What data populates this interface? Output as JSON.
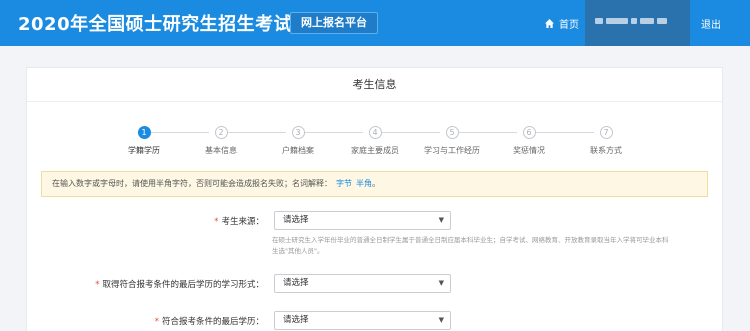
{
  "header": {
    "title": "2020年全国硕士研究生招生考试",
    "platform": "网上报名平台",
    "home": "首页",
    "logout": "退出"
  },
  "card": {
    "title": "考生信息"
  },
  "steps": [
    {
      "num": "1",
      "label": "学籍学历",
      "active": true
    },
    {
      "num": "2",
      "label": "基本信息",
      "active": false
    },
    {
      "num": "3",
      "label": "户籍档案",
      "active": false
    },
    {
      "num": "4",
      "label": "家庭主要成员",
      "active": false
    },
    {
      "num": "5",
      "label": "学习与工作经历",
      "active": false
    },
    {
      "num": "6",
      "label": "奖惩情况",
      "active": false
    },
    {
      "num": "7",
      "label": "联系方式",
      "active": false
    }
  ],
  "notice": {
    "text": "在输入数字或字母时，请使用半角字符，否则可能会造成报名失败；名词解释：",
    "link1": "字节",
    "link2": "半角",
    "end": "。"
  },
  "form": {
    "source": {
      "label": "考生来源：",
      "value": "请选择"
    },
    "source_help": "在硕士研究生入学年份毕业的普通全日制学生属于普通全日制应届本科毕业生；自学考试、网络教育、开放教育录取当年入学将可毕业本科生选\"其他人员\"。",
    "study_form": {
      "label": "取得符合报考条件的最后学历的学习形式：",
      "value": "请选择"
    },
    "last_degree": {
      "label": "符合报考条件的最后学历：",
      "value": "请选择"
    }
  },
  "colors": {
    "header_bg": "#1a8be0",
    "active_step": "#1a8be0",
    "required": "#e84a3d"
  }
}
